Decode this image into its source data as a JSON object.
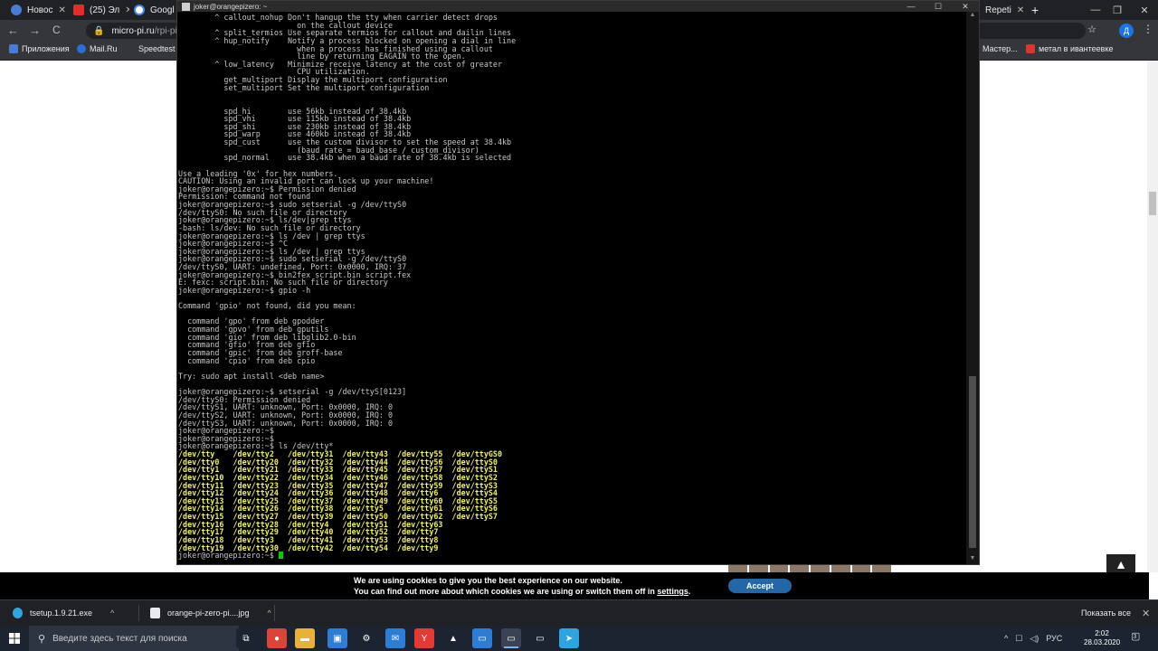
{
  "browser": {
    "tabs": [
      {
        "title": "Новос",
        "color": "#4a7bd6"
      },
      {
        "title": "(25) Эл",
        "color": "#e52d27"
      },
      {
        "title": "Googl",
        "color": "#ffffff"
      }
    ],
    "right_tab": {
      "title": "Repeti"
    },
    "new_tab_symbol": "+",
    "nav": {
      "back": "←",
      "forward": "→",
      "reload": "C"
    },
    "address": {
      "host": "micro-pi.ru",
      "path": "/rpi-pi4/"
    },
    "profile_initial": "Д",
    "bookmarks": [
      {
        "label": "Приложения",
        "color": "#4a7bd6"
      },
      {
        "label": "Mail.Ru",
        "color": "#2d6ed6"
      },
      {
        "label": "Speedtest",
        "color": "#35363a"
      }
    ],
    "bookmarks_right": [
      {
        "label": "Мастер...",
        "color": "#888"
      },
      {
        "label": "метал в ивантеевке",
        "color": "#d33"
      }
    ]
  },
  "terminal": {
    "title": "joker@orangepizero: ~",
    "controls": {
      "minimize": "—",
      "maximize": "☐",
      "close": "✕"
    },
    "lines": [
      "        ^ callout_nohup Don't hangup the tty when carrier detect drops",
      "                          on the callout device",
      "        ^ split_termios Use separate termios for callout and dailin lines",
      "        ^ hup_notify    Notify a process blocked on opening a dial in line",
      "                          when a process has finished using a callout",
      "                          line by returning EAGAIN to the open.",
      "        ^ low_latency   Minimize receive latency at the cost of greater",
      "                          CPU utilization.",
      "          get_multiport Display the multiport configuration",
      "          set_multiport Set the multiport configuration",
      "",
      "",
      "          spd_hi        use 56kb instead of 38.4kb",
      "          spd_vhi       use 115kb instead of 38.4kb",
      "          spd_shi       use 230kb instead of 38.4kb",
      "          spd_warp      use 460kb instead of 38.4kb",
      "          spd_cust      use the custom divisor to set the speed at 38.4kb",
      "                          (baud rate = baud_base / custom_divisor)",
      "          spd_normal    use 38.4kb when a baud rate of 38.4kb is selected",
      "",
      "Use a leading '0x' for hex numbers.",
      "CAUTION: Using an invalid port can lock up your machine!",
      "joker@orangepizero:~$ Permission denied",
      "Permission: command not found",
      "joker@orangepizero:~$ sudo setserial -g /dev/ttyS0",
      "/dev/ttyS0: No such file or directory",
      "joker@orangepizero:~$ ls/dev|grep ttys",
      "-bash: ls/dev: No such file or directory",
      "joker@orangepizero:~$ ls /dev | grep ttys",
      "joker@orangepizero:~$ ^C",
      "joker@orangepizero:~$ ls /dev | grep ttys",
      "joker@orangepizero:~$ sudo setserial -g /dev/ttyS0",
      "/dev/ttyS0, UART: undefined, Port: 0x0000, IRQ: 37",
      "joker@orangepizero:~$ bin2fex script.bin script.fex",
      "E: fexc: script.bin: No such file or directory",
      "joker@orangepizero:~$ gpio -h",
      "",
      "Command 'gpio' not found, did you mean:",
      "",
      "  command 'gpo' from deb gpodder",
      "  command 'gpvo' from deb gputils",
      "  command 'gio' from deb libglib2.0-bin",
      "  command 'gfio' from deb gfio",
      "  command 'gpic' from deb groff-base",
      "  command 'cpio' from deb cpio",
      "",
      "Try: sudo apt install <deb name>",
      "",
      "joker@orangepizero:~$ setserial -g /dev/ttyS[0123]",
      "/dev/ttyS0: Permission denied",
      "/dev/ttyS1, UART: unknown, Port: 0x0000, IRQ: 0",
      "/dev/ttyS2, UART: unknown, Port: 0x0000, IRQ: 0",
      "/dev/ttyS3, UART: unknown, Port: 0x0000, IRQ: 0",
      "joker@orangepizero:~$",
      "joker@orangepizero:~$",
      "joker@orangepizero:~$ ls /dev/tty*"
    ],
    "tty_list": [
      "/dev/tty    /dev/tty2   /dev/tty31  /dev/tty43  /dev/tty55  /dev/ttyGS0",
      "/dev/tty0   /dev/tty20  /dev/tty32  /dev/tty44  /dev/tty56  /dev/ttyS0",
      "/dev/tty1   /dev/tty21  /dev/tty33  /dev/tty45  /dev/tty57  /dev/ttyS1",
      "/dev/tty10  /dev/tty22  /dev/tty34  /dev/tty46  /dev/tty58  /dev/ttyS2",
      "/dev/tty11  /dev/tty23  /dev/tty35  /dev/tty47  /dev/tty59  /dev/ttyS3",
      "/dev/tty12  /dev/tty24  /dev/tty36  /dev/tty48  /dev/tty6   /dev/ttyS4",
      "/dev/tty13  /dev/tty25  /dev/tty37  /dev/tty49  /dev/tty60  /dev/ttyS5",
      "/dev/tty14  /dev/tty26  /dev/tty38  /dev/tty5   /dev/tty61  /dev/ttyS6",
      "/dev/tty15  /dev/tty27  /dev/tty39  /dev/tty50  /dev/tty62  /dev/ttyS7",
      "/dev/tty16  /dev/tty28  /dev/tty4   /dev/tty51  /dev/tty63",
      "/dev/tty17  /dev/tty29  /dev/tty40  /dev/tty52  /dev/tty7",
      "/dev/tty18  /dev/tty3   /dev/tty41  /dev/tty53  /dev/tty8",
      "/dev/tty19  /dev/tty30  /dev/tty42  /dev/tty54  /dev/tty9"
    ],
    "prompt": "joker@orangepizero:~$ "
  },
  "cookie": {
    "line1": "We are using cookies to give you the best experience on our website.",
    "line2_prefix": "You can find out more about which cookies we are using or switch them off in ",
    "settings_link": "settings",
    "line2_suffix": ".",
    "accept_label": "Accept"
  },
  "to_top_symbol": "▲",
  "downloads": {
    "items": [
      {
        "name": "tsetup.1.9.21.exe",
        "color": "#2ca5e0"
      },
      {
        "name": "orange-pi-zero-pi....jpg",
        "color": "#e8eaed"
      }
    ],
    "chevron": "^",
    "show_all": "Показать все",
    "close": "✕"
  },
  "taskbar": {
    "search_placeholder": "Введите здесь текст для поиска",
    "apps": [
      {
        "name": "task-view",
        "glyph": "⧉",
        "color": "#1c2431"
      },
      {
        "name": "chrome",
        "glyph": "●",
        "color": "#db4437"
      },
      {
        "name": "explorer",
        "glyph": "▬",
        "color": "#e8b23a"
      },
      {
        "name": "store",
        "glyph": "▣",
        "color": "#2d7dd2"
      },
      {
        "name": "settings",
        "glyph": "⚙",
        "color": "#1c2431"
      },
      {
        "name": "mail",
        "glyph": "✉",
        "color": "#2d7dd2"
      },
      {
        "name": "yandex",
        "glyph": "Y",
        "color": "#e53935"
      },
      {
        "name": "photos",
        "glyph": "▲",
        "color": "#1c2431"
      },
      {
        "name": "remote-desktop",
        "glyph": "▭",
        "color": "#2d7dd2"
      },
      {
        "name": "putty-active",
        "glyph": "▭",
        "color": "#3a4354"
      },
      {
        "name": "putty-2",
        "glyph": "▭",
        "color": "#1c2431"
      },
      {
        "name": "telegram",
        "glyph": "➤",
        "color": "#2ca5e0"
      }
    ],
    "tray": {
      "chevron": "^",
      "network": "☐",
      "volume": "◁)",
      "lang": "РУС"
    },
    "time": "2:02",
    "date": "28.03.2020",
    "notifications_badge": "3"
  }
}
